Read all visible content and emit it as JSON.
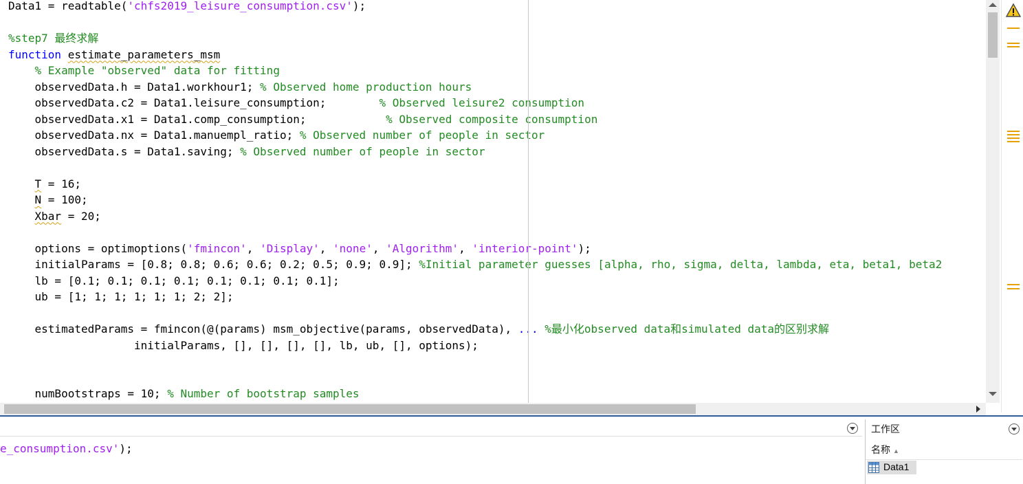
{
  "editor": {
    "lines": [
      [
        {
          "t": "Data1 = readtable("
        },
        {
          "t": "'chfs2019_leisure_consumption.csv'",
          "c": "str"
        },
        {
          "t": ");"
        }
      ],
      [],
      [
        {
          "t": "%step7 最终求解",
          "c": "cmt"
        }
      ],
      [
        {
          "t": "function",
          "c": "kw"
        },
        {
          "t": " "
        },
        {
          "t": "estimate_parameters_msm",
          "c": "squig"
        }
      ],
      [
        {
          "t": "    "
        },
        {
          "t": "% Example \"observed\" data for fitting",
          "c": "cmt"
        }
      ],
      [
        {
          "t": "    observedData.h = Data1.workhour1; "
        },
        {
          "t": "% Observed home production hours",
          "c": "cmt"
        }
      ],
      [
        {
          "t": "    observedData.c2 = Data1.leisure_consumption;        "
        },
        {
          "t": "% Observed leisure2 consumption",
          "c": "cmt"
        }
      ],
      [
        {
          "t": "    observedData.x1 = Data1.comp_consumption;            "
        },
        {
          "t": "% Observed composite consumption",
          "c": "cmt"
        }
      ],
      [
        {
          "t": "    observedData.nx = Data1.manuempl_ratio; "
        },
        {
          "t": "% Observed number of people in sector",
          "c": "cmt"
        }
      ],
      [
        {
          "t": "    observedData.s = Data1.saving; "
        },
        {
          "t": "% Observed number of people in sector",
          "c": "cmt"
        }
      ],
      [],
      [
        {
          "t": "    "
        },
        {
          "t": "T",
          "c": "squig"
        },
        {
          "t": " = 16;"
        }
      ],
      [
        {
          "t": "    "
        },
        {
          "t": "N",
          "c": "squig"
        },
        {
          "t": " = 100;"
        }
      ],
      [
        {
          "t": "    "
        },
        {
          "t": "Xbar",
          "c": "squig"
        },
        {
          "t": " = 20;"
        }
      ],
      [],
      [
        {
          "t": "    options = optimoptions("
        },
        {
          "t": "'fmincon'",
          "c": "str"
        },
        {
          "t": ", "
        },
        {
          "t": "'Display'",
          "c": "str"
        },
        {
          "t": ", "
        },
        {
          "t": "'none'",
          "c": "str"
        },
        {
          "t": ", "
        },
        {
          "t": "'Algorithm'",
          "c": "str"
        },
        {
          "t": ", "
        },
        {
          "t": "'interior-point'",
          "c": "str"
        },
        {
          "t": ");"
        }
      ],
      [
        {
          "t": "    initialParams = [0.8; 0.8; 0.6; 0.6; 0.2; 0.5; 0.9; 0.9]; "
        },
        {
          "t": "%Initial parameter guesses [alpha, rho, sigma, delta, lambda, eta, beta1, beta2",
          "c": "cmt"
        }
      ],
      [
        {
          "t": "    lb = [0.1; 0.1; 0.1; 0.1; 0.1; 0.1; 0.1; 0.1];"
        }
      ],
      [
        {
          "t": "    ub = [1; 1; 1; 1; 1; 1; 2; 2];"
        }
      ],
      [],
      [
        {
          "t": "    estimatedParams = fmincon(@(params) msm_objective(params, observedData), "
        },
        {
          "t": "...",
          "c": "cont"
        },
        {
          "t": " "
        },
        {
          "t": "%最小化observed data和simulated data的区别求解",
          "c": "cmt"
        }
      ],
      [
        {
          "t": "                   initialParams, [], [], [], [], lb, ub, [], options);"
        }
      ],
      [],
      [],
      [
        {
          "t": "    numBootstraps = 10; "
        },
        {
          "t": "% Number of bootstrap samples",
          "c": "cmt"
        }
      ]
    ]
  },
  "command_window": {
    "line": [
      {
        "t": "e_consumption.csv'",
        "c": "str"
      },
      {
        "t": ");"
      }
    ]
  },
  "workspace": {
    "title": "工作区",
    "column_name": "名称",
    "sort_indicator": "▲",
    "variables": [
      {
        "name": "Data1"
      }
    ]
  },
  "analyzer": {
    "icon": "warning-triangle-icon",
    "marker_color": "#e5a100"
  }
}
